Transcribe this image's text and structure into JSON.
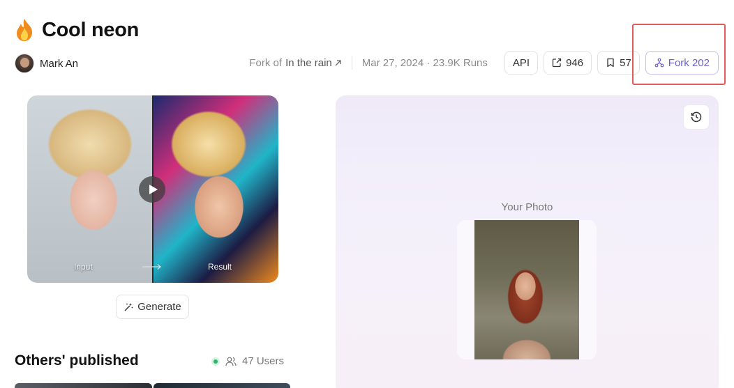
{
  "page": {
    "title": "Cool neon",
    "title_icon": "flame-icon"
  },
  "author": {
    "name": "Mark An"
  },
  "meta": {
    "fork_of_prefix": "Fork of",
    "fork_of_link": "In the rain",
    "date_runs": "Mar 27, 2024 · 23.9K Runs",
    "api_label": "API",
    "shares": "946",
    "saves": "57",
    "fork_label": "Fork 202"
  },
  "preview": {
    "input_label": "Input",
    "result_label": "Result"
  },
  "generate": {
    "label": "Generate"
  },
  "others": {
    "heading": "Others' published",
    "users": "47 Users"
  },
  "panel": {
    "your_photo_label": "Your Photo"
  },
  "colors": {
    "fork_accent": "#6b5fd0",
    "highlight": "#e05a5a",
    "online": "#2cb566"
  }
}
